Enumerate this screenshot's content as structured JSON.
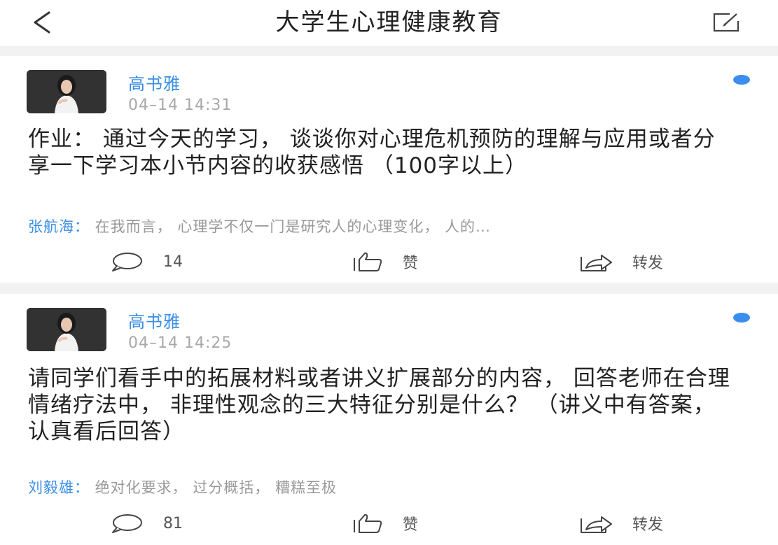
{
  "nav": {
    "title": "大学生心理健康教育",
    "back_icon": "chevron-left-icon",
    "edit_icon": "edit-icon"
  },
  "colors": {
    "accent": "#3a8ee6",
    "unread_dot": "#3b8ef0",
    "divider": "#f2f2f2"
  },
  "posts": [
    {
      "author": "高书雅",
      "time": "04–14 14:31",
      "content": "作业： 通过今天的学习， 谈谈你对心理危机预防的理解与应用或者分享一下学习本小节内容的收获感悟 （100字以上）",
      "comment_author": "张航海：",
      "comment_text": " 在我而言， 心理学不仅一门是研究人的心理变化， 人的…",
      "comment_count": "14",
      "like_label": "赞",
      "share_label": "转发"
    },
    {
      "author": "高书雅",
      "time": "04–14 14:25",
      "content": "请同学们看手中的拓展材料或者讲义扩展部分的内容， 回答老师在合理情绪疗法中， 非理性观念的三大特征分别是什么？ （讲义中有答案， 认真看后回答）",
      "comment_author": "刘毅雄：",
      "comment_text": " 绝对化要求， 过分概括， 糟糕至极",
      "comment_count": "81",
      "like_label": "赞",
      "share_label": "转发"
    }
  ]
}
